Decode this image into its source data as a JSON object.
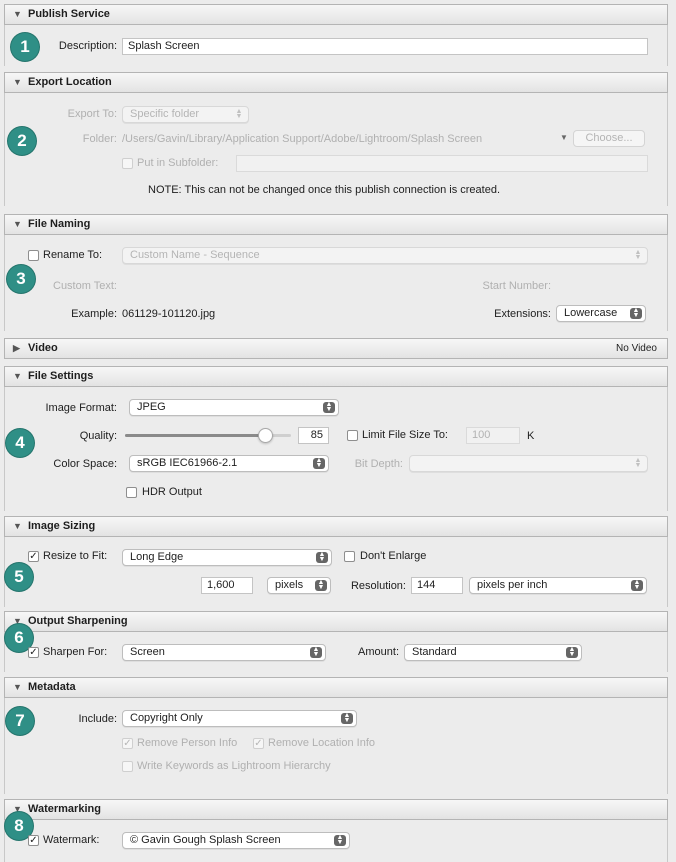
{
  "colors": {
    "badge": "#2f8f86",
    "background": "#ececec"
  },
  "badges": [
    "1",
    "2",
    "3",
    "4",
    "5",
    "6",
    "7",
    "8"
  ],
  "publish_service": {
    "title": "Publish Service",
    "description_label": "Description:",
    "description_value": "Splash Screen"
  },
  "export_location": {
    "title": "Export Location",
    "export_to_label": "Export To:",
    "export_to_value": "Specific folder",
    "folder_label": "Folder:",
    "folder_path": "/Users/Gavin/Library/Application Support/Adobe/Lightroom/Splash Screen",
    "choose_button": "Choose...",
    "subfolder_label": "Put in Subfolder:",
    "note": "NOTE: This can not be changed once this publish connection is created."
  },
  "file_naming": {
    "title": "File Naming",
    "rename_label": "Rename To:",
    "rename_template": "Custom Name - Sequence",
    "custom_text_label": "Custom Text:",
    "start_number_label": "Start Number:",
    "example_label": "Example:",
    "example_value": "061129-101120.jpg",
    "extensions_label": "Extensions:",
    "extensions_value": "Lowercase"
  },
  "video": {
    "title": "Video",
    "summary": "No Video"
  },
  "file_settings": {
    "title": "File Settings",
    "format_label": "Image Format:",
    "format_value": "JPEG",
    "quality_label": "Quality:",
    "quality_value": "85",
    "quality_fraction": 0.85,
    "limit_label": "Limit File Size To:",
    "limit_value": "100",
    "limit_unit": "K",
    "color_space_label": "Color Space:",
    "color_space_value": "sRGB IEC61966-2.1",
    "bit_depth_label": "Bit Depth:",
    "hdr_label": "HDR Output"
  },
  "image_sizing": {
    "title": "Image Sizing",
    "resize_label": "Resize to Fit:",
    "resize_value": "Long Edge",
    "dont_enlarge_label": "Don't Enlarge",
    "size_value": "1,600",
    "size_unit": "pixels",
    "resolution_label": "Resolution:",
    "resolution_value": "144",
    "resolution_unit": "pixels per inch"
  },
  "output_sharpening": {
    "title": "Output Sharpening",
    "sharpen_label": "Sharpen For:",
    "sharpen_value": "Screen",
    "amount_label": "Amount:",
    "amount_value": "Standard"
  },
  "metadata": {
    "title": "Metadata",
    "include_label": "Include:",
    "include_value": "Copyright Only",
    "remove_person": "Remove Person Info",
    "remove_location": "Remove Location Info",
    "keywords_hierarchy": "Write Keywords as Lightroom Hierarchy"
  },
  "watermarking": {
    "title": "Watermarking",
    "watermark_label": "Watermark:",
    "watermark_value": "© Gavin Gough Splash Screen"
  },
  "glyphs": {
    "expanded": "▼",
    "collapsed": "▶",
    "check": "✓",
    "up": "▲",
    "down": "▼"
  }
}
